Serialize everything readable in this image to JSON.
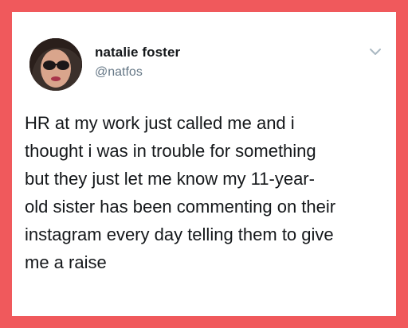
{
  "tweet": {
    "author": {
      "display_name": "natalie foster",
      "handle": "@natfos",
      "avatar": "avatar-photo"
    },
    "menu_icon": "chevron-down-icon",
    "text": "HR at my work just called me and i\nthought i was in trouble for something\nbut they just let me know my 11-year-\nold sister has been commenting on their\ninstagram every day telling them to give\nme a raise"
  },
  "colors": {
    "background": "#f0595c",
    "card": "#ffffff",
    "text": "#14171a",
    "secondary_text": "#657786"
  }
}
